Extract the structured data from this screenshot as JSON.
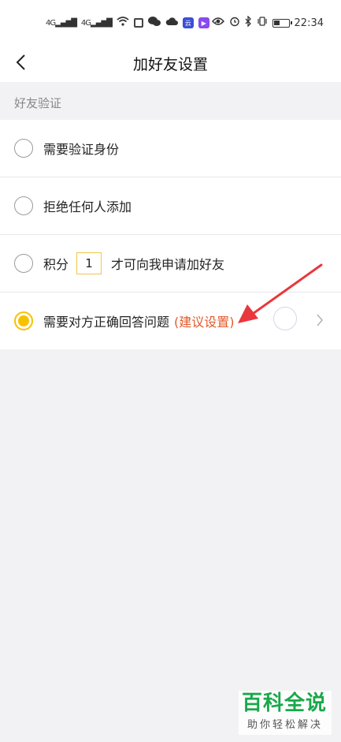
{
  "status_bar": {
    "signal1": "4G",
    "signal2": "4G",
    "app_badge": "云",
    "time": "22:34"
  },
  "nav": {
    "title": "加好友设置"
  },
  "section": {
    "header": "好友验证"
  },
  "options": [
    {
      "label": "需要验证身份",
      "selected": false
    },
    {
      "label": "拒绝任何人添加",
      "selected": false
    },
    {
      "label_prefix": "积分",
      "points_value": "1",
      "label_suffix": "才可向我申请加好友",
      "selected": false
    },
    {
      "label": "需要对方正确回答问题",
      "note": "(建议设置)",
      "selected": true
    }
  ],
  "watermark": {
    "main": "百科全说",
    "sub": "助你轻松解决"
  },
  "colors": {
    "accent_yellow": "#f8c100",
    "suggest_red": "#e05a2b",
    "annotation_red": "#e8383d",
    "watermark_green": "#19a84a"
  }
}
